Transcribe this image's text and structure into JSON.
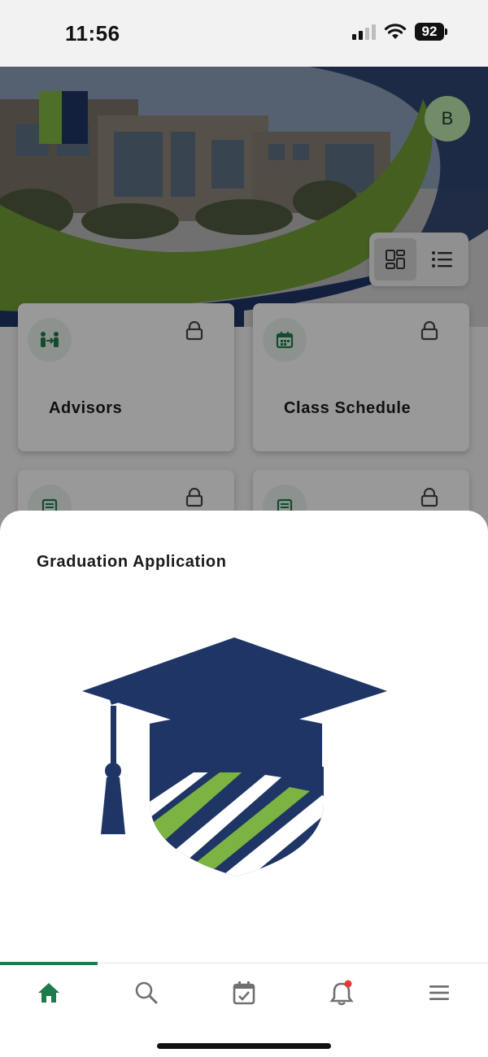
{
  "status": {
    "time": "11:56",
    "battery": "92"
  },
  "header": {
    "avatar_initial": "B"
  },
  "view_toggle": {
    "selected": "grid",
    "options": [
      "grid-view-icon",
      "list-view-icon"
    ]
  },
  "cards": [
    {
      "label": "Advisors",
      "icon": "advisors-icon",
      "locked": true
    },
    {
      "label": "Class Schedule",
      "icon": "calendar-icon",
      "locked": true
    },
    {
      "label": "",
      "icon": "document-icon",
      "locked": true
    },
    {
      "label": "",
      "icon": "document-icon",
      "locked": true
    }
  ],
  "sheet": {
    "title": "Graduation Application"
  },
  "bottom_nav": {
    "items": [
      "home-icon",
      "search-icon",
      "calendar-check-icon",
      "bell-icon",
      "menu-icon"
    ],
    "active": "home-icon",
    "notification_dot": true
  },
  "colors": {
    "brand_green": "#1f7a4b",
    "logo_navy": "#1e3565",
    "logo_green": "#7cb342",
    "notification_red": "#e53935"
  }
}
